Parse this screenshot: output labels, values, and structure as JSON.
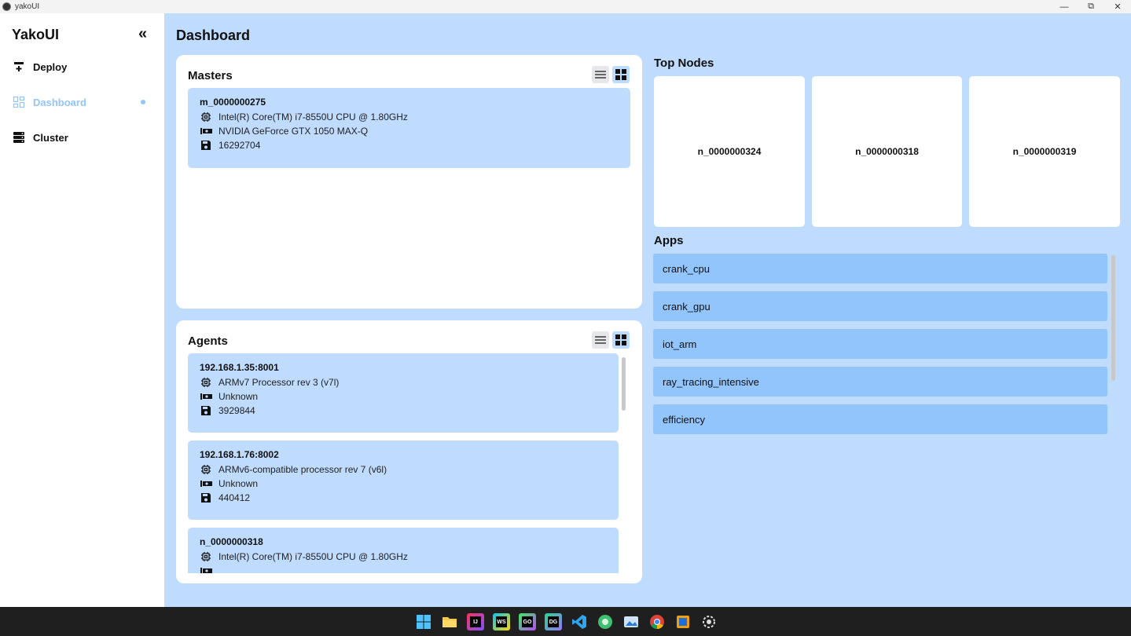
{
  "window": {
    "title": "yakoUI",
    "minimize": "—",
    "maximize": "⧉",
    "close": "✕"
  },
  "sidebar": {
    "brand": "YakoUI",
    "collapse_glyph": "«",
    "items": [
      {
        "label": "Deploy",
        "icon": "deploy-icon"
      },
      {
        "label": "Dashboard",
        "icon": "dashboard-icon",
        "active": true
      },
      {
        "label": "Cluster",
        "icon": "cluster-icon"
      }
    ]
  },
  "main": {
    "title": "Dashboard",
    "masters": {
      "title": "Masters",
      "cards": [
        {
          "name": "m_0000000275",
          "cpu": "Intel(R) Core(TM) i7-8550U CPU @ 1.80GHz",
          "gpu": "NVIDIA GeForce GTX 1050 MAX-Q",
          "memory": "16292704"
        }
      ]
    },
    "agents": {
      "title": "Agents",
      "cards": [
        {
          "name": "192.168.1.35:8001",
          "cpu": "ARMv7 Processor rev 3 (v7l)",
          "gpu": "Unknown",
          "memory": "3929844"
        },
        {
          "name": "192.168.1.76:8002",
          "cpu": "ARMv6-compatible processor rev 7 (v6l)",
          "gpu": "Unknown",
          "memory": "440412"
        },
        {
          "name": "n_0000000318",
          "cpu": "Intel(R) Core(TM) i7-8550U CPU @ 1.80GHz",
          "gpu": "",
          "memory": ""
        }
      ]
    },
    "top_nodes": {
      "title": "Top Nodes",
      "nodes": [
        "n_0000000324",
        "n_0000000318",
        "n_0000000319"
      ]
    },
    "apps": {
      "title": "Apps",
      "items": [
        "crank_cpu",
        "crank_gpu",
        "iot_arm",
        "ray_tracing_intensive",
        "efficiency"
      ]
    }
  },
  "taskbar": {
    "icons": [
      "windows-start-icon",
      "file-explorer-icon",
      "intellij-icon",
      "webstorm-icon",
      "goland-icon",
      "datagrip-icon",
      "vscode-icon",
      "browser-icon",
      "photos-icon",
      "chrome-icon",
      "virtualbox-icon",
      "yakoui-app-icon"
    ]
  },
  "colors": {
    "background": "#bfdbfe",
    "accent": "#93c5fd",
    "panel": "#ffffff",
    "taskbar": "#1f1f1f"
  }
}
